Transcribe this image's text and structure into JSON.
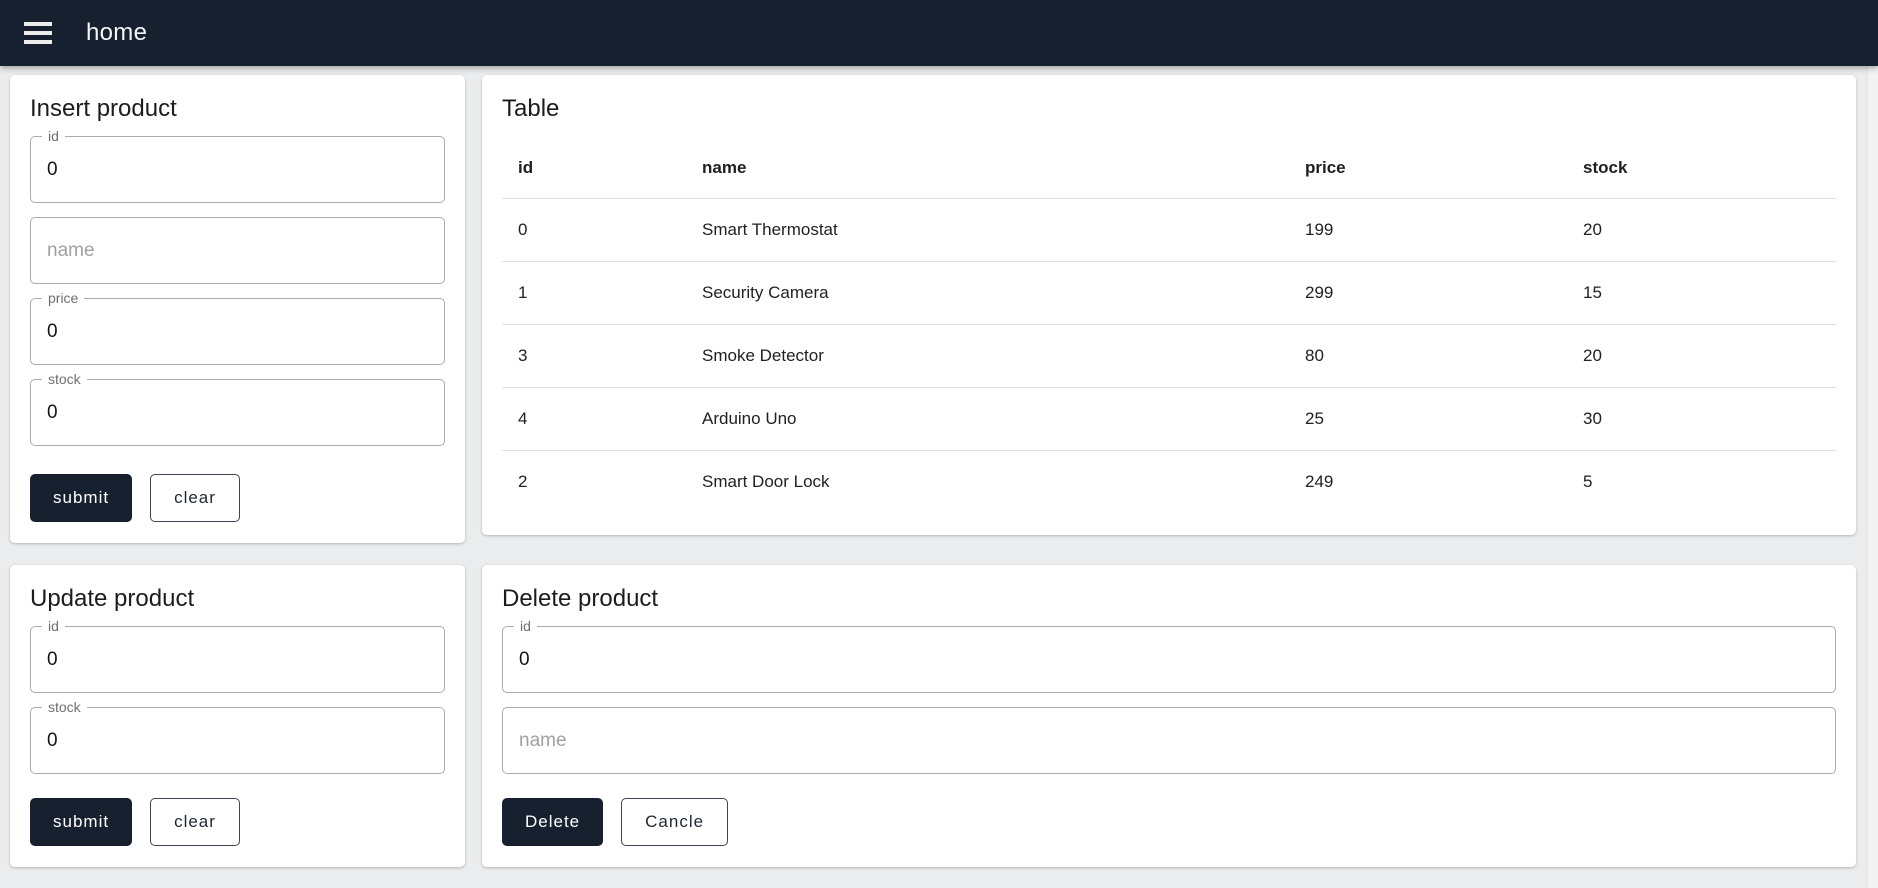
{
  "colors": {
    "primary": "#17202e",
    "background": "#ebeced"
  },
  "app_bar": {
    "title": "home"
  },
  "insert_card": {
    "title": "Insert product",
    "fields": {
      "id": {
        "label": "id",
        "value": "0"
      },
      "name": {
        "placeholder": "name"
      },
      "price": {
        "label": "price",
        "value": "0"
      },
      "stock": {
        "label": "stock",
        "value": "0"
      }
    },
    "buttons": {
      "submit": "submit",
      "clear": "clear"
    }
  },
  "table_card": {
    "title": "Table",
    "columns": [
      "id",
      "name",
      "price",
      "stock"
    ],
    "rows": [
      {
        "id": "0",
        "name": "Smart Thermostat",
        "price": "199",
        "stock": "20"
      },
      {
        "id": "1",
        "name": "Security Camera",
        "price": "299",
        "stock": "15"
      },
      {
        "id": "3",
        "name": "Smoke Detector",
        "price": "80",
        "stock": "20"
      },
      {
        "id": "4",
        "name": "Arduino Uno",
        "price": "25",
        "stock": "30"
      },
      {
        "id": "2",
        "name": "Smart Door Lock",
        "price": "249",
        "stock": "5"
      }
    ]
  },
  "update_card": {
    "title": "Update product",
    "fields": {
      "id": {
        "label": "id",
        "value": "0"
      },
      "stock": {
        "label": "stock",
        "value": "0"
      }
    },
    "buttons": {
      "submit": "submit",
      "clear": "clear"
    }
  },
  "delete_card": {
    "title": "Delete product",
    "fields": {
      "id": {
        "label": "id",
        "value": "0"
      },
      "name": {
        "placeholder": "name"
      }
    },
    "buttons": {
      "delete": "Delete",
      "cancel": "Cancle"
    }
  }
}
